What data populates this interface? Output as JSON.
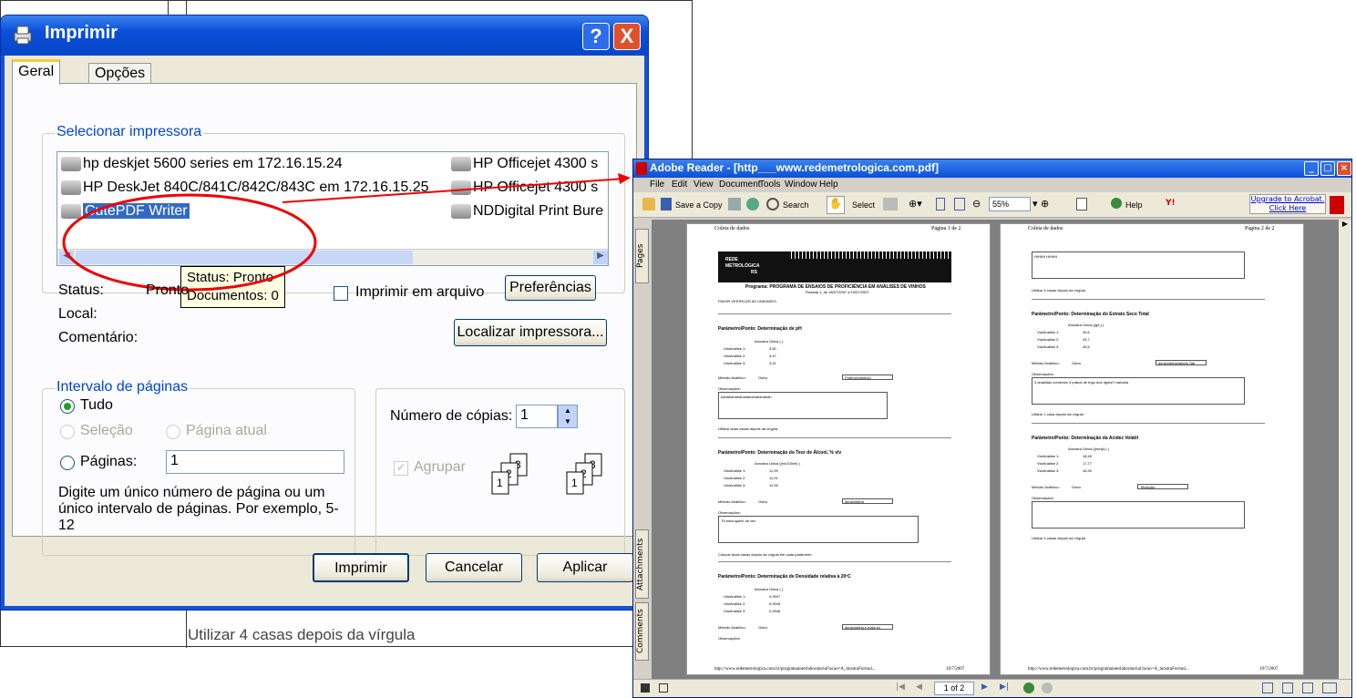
{
  "background_doc": {
    "text": "Utilizar 4 casas depois da vírgula"
  },
  "print_dialog": {
    "title": "Imprimir",
    "help_btn": "?",
    "close_btn": "X",
    "tabs": [
      "Geral",
      "Opções"
    ],
    "printer_group_label": "Selecionar impressora",
    "printers_left": [
      "hp deskjet 5600 series em 172.16.15.24",
      "HP DeskJet 840C/841C/842C/843C em 172.16.15.25",
      "CutePDF Writer"
    ],
    "printers_right": [
      "HP Officejet 4300 s",
      "HP Officejet 4300 s",
      "NDDigital Print Bure"
    ],
    "tooltip_status": "Status: Pronto",
    "tooltip_docs": "Documentos: 0",
    "status_label": "Status:",
    "status_value": "Pronto",
    "local_label": "Local:",
    "comment_label": "Comentário:",
    "print_to_file": "Imprimir em arquivo",
    "preferences_btn": "Preferências",
    "find_printer_btn": "Localizar impressora...",
    "page_range_label": "Intervalo de páginas",
    "opt_all": "Tudo",
    "opt_selection": "Seleção",
    "opt_current": "Página atual",
    "opt_pages": "Páginas:",
    "pages_value": "1",
    "hint": "Digite um único número de página ou um único intervalo de páginas. Por exemplo, 5-12",
    "copies_label": "Número de cópias:",
    "copies_value": "1",
    "collate_label": "Agrupar",
    "print_btn": "Imprimir",
    "cancel_btn": "Cancelar",
    "apply_btn": "Aplicar"
  },
  "adobe": {
    "title": "Adobe Reader - [http___www.redemetrologica.com.pdf]",
    "menu": [
      "File",
      "Edit",
      "View",
      "Document",
      "Tools",
      "Window",
      "Help"
    ],
    "save_copy": "Save a Copy",
    "search": "Search",
    "select": "Select",
    "zoom": "55%",
    "help": "Help",
    "upgrade1": "Upgrade to Acrobat.",
    "upgrade2": "Click Here",
    "side_tabs": [
      "Pages",
      "Attachments",
      "Comments"
    ],
    "page_nav": "1 of 2",
    "page1": {
      "header_left": "Coleta de dados",
      "header_right": "Página 1 de 2",
      "logo1": "REDE",
      "logo2": "METROLÓGICA",
      "logo3": "RS",
      "program": "Programa: PROGRAMA DE ENSAIOS DE PROFICIÊNCIA EM ANÁLISES DE VINHOS",
      "rodada": "Rodada 1, de 18/07/2007 a 19/07/2007",
      "verify": "FAVOR VERIFICAR AS UNIDADES.",
      "p1_title": "Parâmetro/Ponto: Determinação de pH",
      "p1_sample": "Amostra Única ( )",
      "p1_rows": [
        [
          "Via/Análise 1:",
          "3,50"
        ],
        [
          "Via/Análise 2:",
          "3,47"
        ],
        [
          "Via/Análise 3:",
          "3,41"
        ]
      ],
      "p1_method": "Potenciometrico",
      "p1_obs": "hahahahahahahahahahahahah",
      "p1_note": "Utilizar duas casas depois da vírgula.",
      "p2_title": "Parâmetro/Ponto: Determinação do Teor de Álcool, % v/v",
      "p2_sample": "Amostra Única ((ml/100ml) )",
      "p2_rows": [
        [
          "Via/Análise 1:",
          "11,99"
        ],
        [
          "Via/Análise 2:",
          "11,91"
        ],
        [
          "Via/Análise 3:",
          "11,95"
        ]
      ],
      "p2_method": "densimetria",
      "p2_obs": "Tô enlouquecI de vez",
      "p2_note": "Colocar duas casas depois da vírgula em cada parâmetro.",
      "p3_title": "Parâmetro/Ponto: Determinação de Densidade relativa à 20ºC",
      "p3_sample": "Amostra Única ( )",
      "p3_rows": [
        [
          "Via/Análise 1:",
          "0,9947"
        ],
        [
          "Via/Análise 2:",
          "0,9945"
        ],
        [
          "Via/Análise 3:",
          "0,9946"
        ]
      ],
      "p3_method": "densimetria e mais só",
      "method_label": "Método Analítico:",
      "method_sel": "Outro",
      "obs_label": "Observações:",
      "footer": "http://www.redemetrologica.com.br/programainterlaboratorial?acao=A_mostraFormul...",
      "footer_date": "19/7/2007"
    },
    "page2": {
      "header_left": "Coleta de dados",
      "header_right": "Página 2 de 2",
      "top_obs": "HIHIHI HIHIHI",
      "note0": "Utilizar 4 casas depois da vírgula.",
      "q1_title": "Parâmetro/Ponto: Determinação do Extrato Seco Total",
      "q1_sample": "Amostra Única ((g/L) )",
      "q1_rows": [
        [
          "Via/Análise 1:",
          "26,6"
        ],
        [
          "Via/Análise 2:",
          "26,7"
        ],
        [
          "Via/Análise 3:",
          "26,5"
        ]
      ],
      "q1_method": "densimetria/tabela Tab",
      "q1_obs": "3 analistas comeram 3 pratos de trigo dos tigres!!! hahaha",
      "q1_note": "Utilizar 1 casa depois da vírgula.",
      "q2_title": "Parâmetro/Ponto: Determinação da Acidez Volátil",
      "q2_sample": "Amostra Única ((meq/L) )",
      "q2_rows": [
        [
          "Via/Análise 1:",
          "18,49"
        ],
        [
          "Via/Análise 2:",
          "17,77"
        ],
        [
          "Via/Análise 3:",
          "16,90"
        ]
      ],
      "q2_method": "Titulação",
      "q2_note": "Utilizar 4 casas depois da vírgula."
    }
  }
}
